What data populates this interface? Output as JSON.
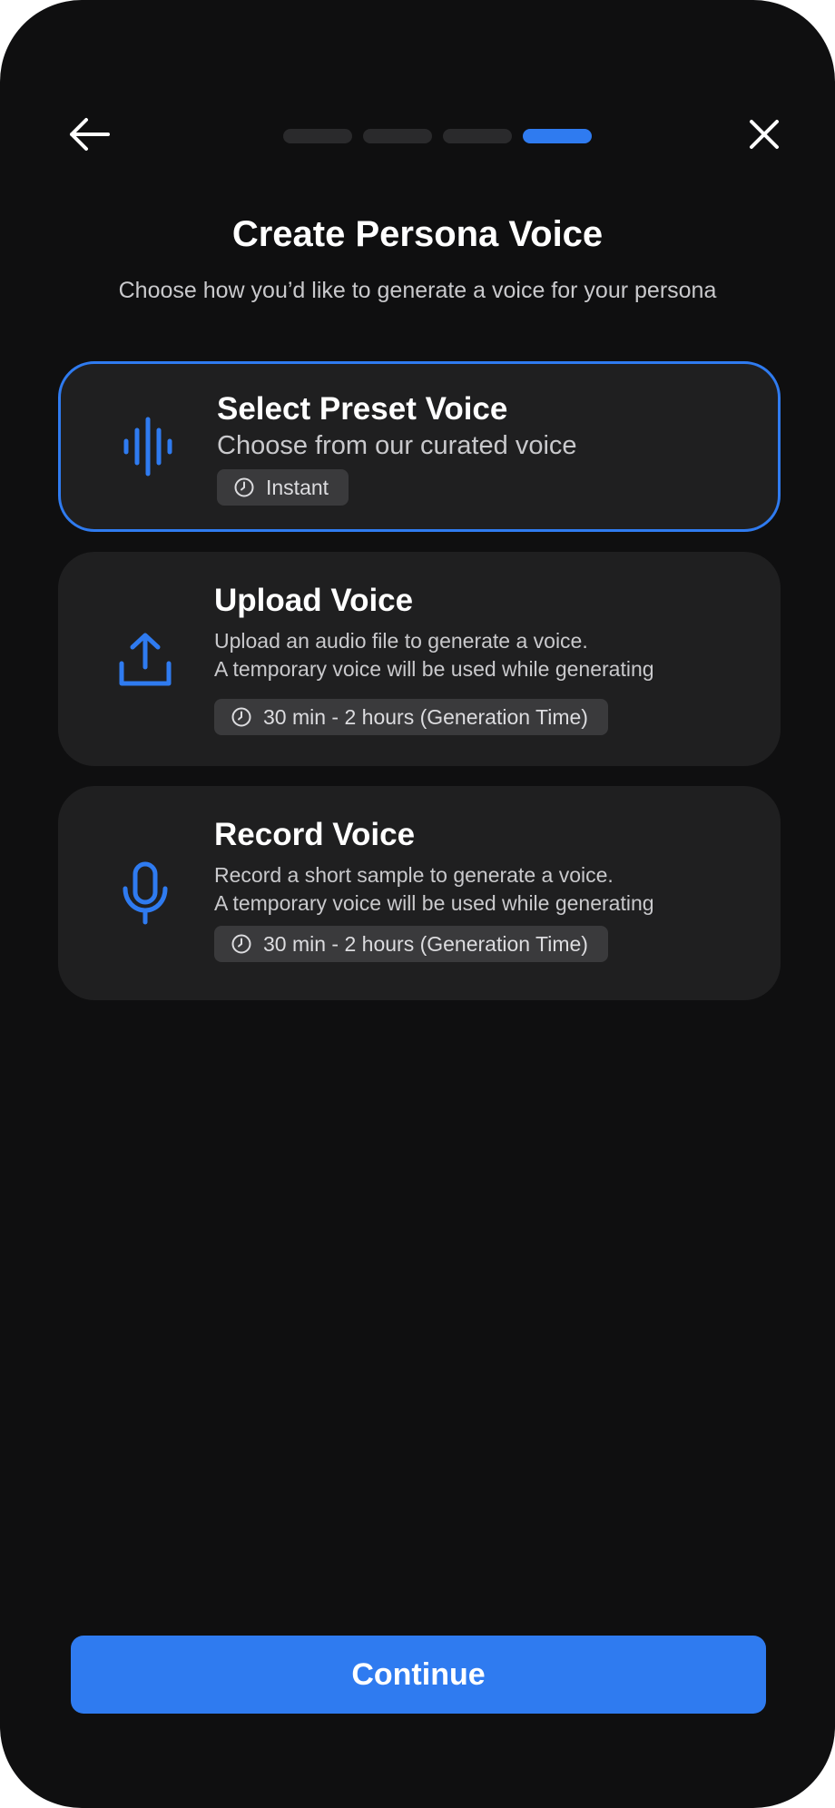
{
  "header": {
    "back_icon": "arrow-left-icon",
    "close_icon": "close-icon",
    "progress": {
      "total_steps": 4,
      "current_step": 4
    }
  },
  "title": "Create Persona Voice",
  "subtitle": "Choose how you’d like to generate a voice for your persona",
  "options": [
    {
      "icon": "waveform-icon",
      "title": "Select Preset Voice",
      "description": [
        "Choose from our curated voice"
      ],
      "badge": "Instant",
      "selected": true
    },
    {
      "icon": "upload-icon",
      "title": "Upload Voice",
      "description": [
        "Upload an audio file to generate a voice.",
        "A temporary voice will be used while generating"
      ],
      "badge": "30 min - 2 hours (Generation Time)",
      "selected": false
    },
    {
      "icon": "microphone-icon",
      "title": "Record Voice",
      "description": [
        "Record a short sample to generate a voice.",
        "A temporary voice will be used while generating"
      ],
      "badge": "30 min - 2 hours (Generation Time)",
      "selected": false
    }
  ],
  "continue_label": "Continue",
  "colors": {
    "accent": "#2f7bf0",
    "background": "#0f0f10",
    "card": "#1f1f20",
    "badge": "#3a3a3c"
  }
}
